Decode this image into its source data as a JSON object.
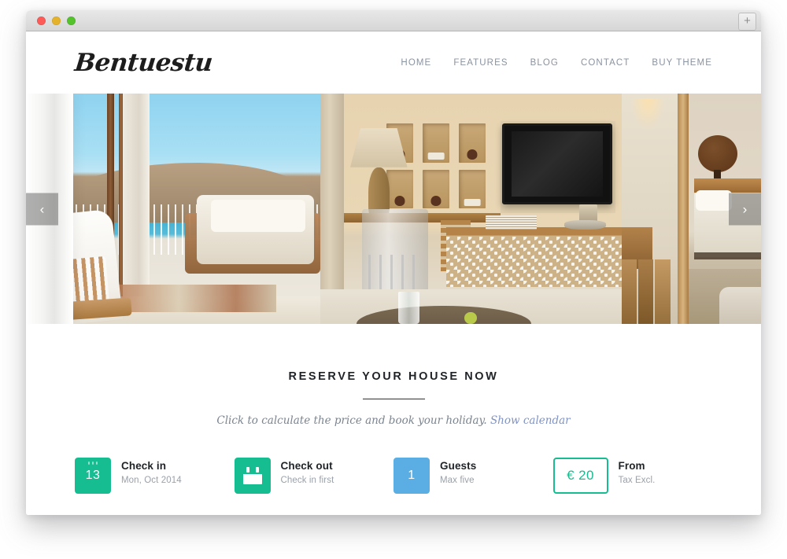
{
  "browser": {
    "traffic_lights": [
      "close",
      "minimize",
      "zoom"
    ],
    "new_tab_label": "+"
  },
  "site": {
    "logo": "Bentuestu",
    "nav": [
      {
        "label": "HOME"
      },
      {
        "label": "FEATURES"
      },
      {
        "label": "BLOG"
      },
      {
        "label": "CONTACT"
      },
      {
        "label": "BUY THEME"
      }
    ]
  },
  "hero": {
    "prev_arrow": "‹",
    "next_arrow": "›"
  },
  "reserve": {
    "title": "RESERVE YOUR HOUSE NOW",
    "subtitle_text": "Click to calculate the price and book your holiday.",
    "subtitle_link": "Show calendar"
  },
  "booking": [
    {
      "icon": "calendar-date-icon",
      "icon_value": "13",
      "title": "Check in",
      "subtitle": "Mon, Oct 2014",
      "color": "#15bd90"
    },
    {
      "icon": "calendar-blank-icon",
      "icon_value": "",
      "title": "Check out",
      "subtitle": "Check in first",
      "color": "#15bd90"
    },
    {
      "icon": "guests-count-icon",
      "icon_value": "1",
      "title": "Guests",
      "subtitle": "Max five",
      "color": "#5aaee3"
    },
    {
      "icon": "price-box-icon",
      "icon_value": "€ 20",
      "title": "From",
      "subtitle": "Tax Excl.",
      "color": "#15bd90"
    }
  ],
  "colors": {
    "teal": "#15bd90",
    "blue": "#5aaee3",
    "nav_text": "#8a93a0",
    "heading": "#1f2327",
    "muted": "#9aa1a9",
    "link": "#7f93c4"
  }
}
